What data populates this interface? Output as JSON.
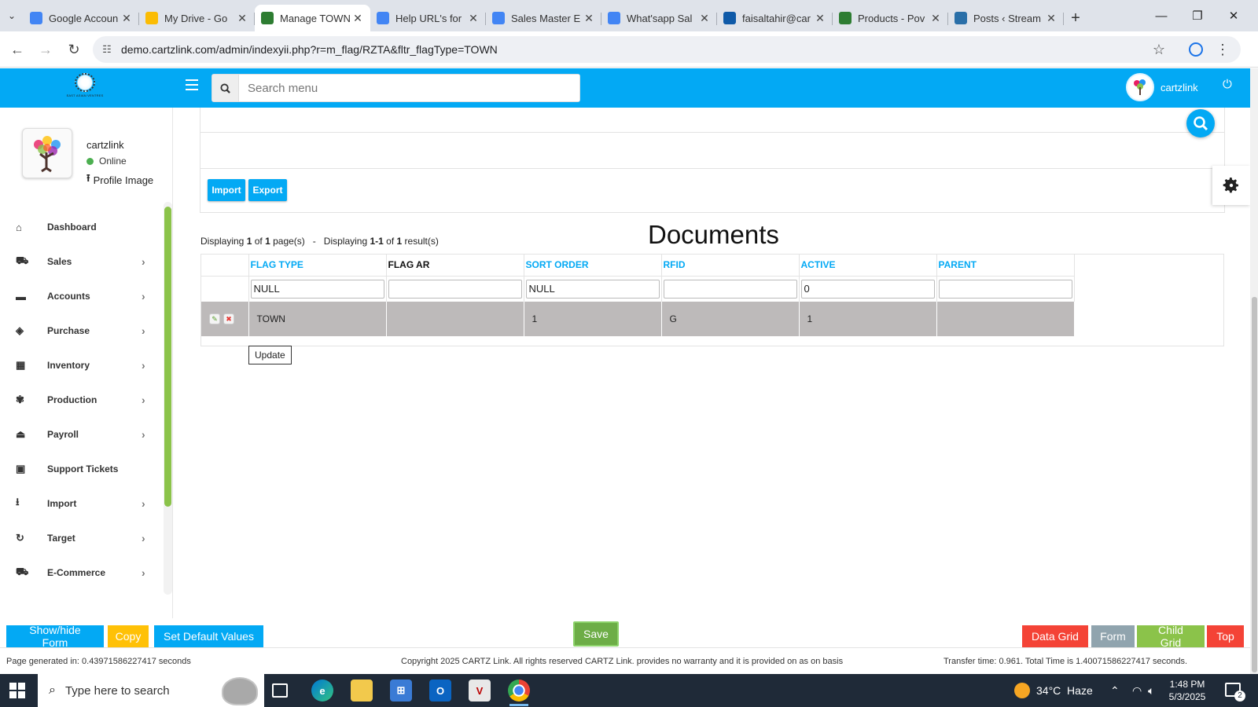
{
  "browser": {
    "tabs": [
      {
        "title": "Google Accoun",
        "favicon": "google-icon",
        "color": "#4285f4"
      },
      {
        "title": "My Drive - Go",
        "favicon": "drive-icon",
        "color": "#fbbc04"
      },
      {
        "title": "Manage TOWN",
        "favicon": "cartzlink-icon",
        "color": "#2e7d32",
        "active": true
      },
      {
        "title": "Help URL's for",
        "favicon": "docs-icon",
        "color": "#4285f4"
      },
      {
        "title": "Sales Master E",
        "favicon": "docs-icon",
        "color": "#4285f4"
      },
      {
        "title": "What'sapp Sal",
        "favicon": "docs-icon",
        "color": "#4285f4"
      },
      {
        "title": "faisaltahir@car",
        "favicon": "mail-icon",
        "color": "#0f5aa8"
      },
      {
        "title": "Products - Pov",
        "favicon": "cartzlink-icon",
        "color": "#2e7d32"
      },
      {
        "title": "Posts ‹ Stream",
        "favicon": "wordpress-icon",
        "color": "#2a6fa8"
      }
    ],
    "url": "demo.cartzlink.com/admin/indexyii.php?r=m_flag/RZTA&fltr_flagType=TOWN"
  },
  "header": {
    "logo_text": "EAST ASIAN VENTRES",
    "search_placeholder": "Search menu",
    "user_name": "cartzlink",
    "accent": "#03a9f4"
  },
  "profile": {
    "name": "cartzlink",
    "status": "Online",
    "upload_label": "Profile Image"
  },
  "sidebar": {
    "items": [
      {
        "label": "Dashboard",
        "icon": "home-icon",
        "glyph": "⌂",
        "has_children": false
      },
      {
        "label": "Sales",
        "icon": "cart-icon",
        "glyph": "⛟",
        "has_children": true
      },
      {
        "label": "Accounts",
        "icon": "briefcase-icon",
        "glyph": "▬",
        "has_children": true
      },
      {
        "label": "Purchase",
        "icon": "tags-icon",
        "glyph": "◈",
        "has_children": true
      },
      {
        "label": "Inventory",
        "icon": "grid-icon",
        "glyph": "▦",
        "has_children": true
      },
      {
        "label": "Production",
        "icon": "cogs-icon",
        "glyph": "✾",
        "has_children": true
      },
      {
        "label": "Payroll",
        "icon": "money-icon",
        "glyph": "⏏",
        "has_children": true
      },
      {
        "label": "Support Tickets",
        "icon": "ticket-icon",
        "glyph": "▣",
        "has_children": false
      },
      {
        "label": "Import",
        "icon": "download-icon",
        "glyph": "⭳",
        "has_children": true
      },
      {
        "label": "Target",
        "icon": "refresh-icon",
        "glyph": "↻",
        "has_children": true
      },
      {
        "label": "E-Commerce",
        "icon": "shopping-cart-icon",
        "glyph": "⛟",
        "has_children": true
      }
    ]
  },
  "toolbar": {
    "import_label": "Import",
    "export_label": "Export"
  },
  "listing": {
    "displaying_pages_prefix": "Displaying ",
    "page_current": "1",
    "of": " of ",
    "page_total": "1",
    "pages_suffix": " page(s)   -   Displaying ",
    "range": "1-1",
    "of2": " of ",
    "result_total": "1",
    "results_suffix": " result(s)",
    "title": "Documents"
  },
  "grid": {
    "columns": [
      "FLAG TYPE",
      "FLAG AR",
      "SORT ORDER",
      "RFID",
      "ACTIVE",
      "PARENT"
    ],
    "filters": [
      "NULL",
      "",
      "NULL",
      "",
      "0",
      ""
    ],
    "rows": [
      [
        "TOWN",
        "",
        "1",
        "G",
        "1",
        ""
      ]
    ],
    "tooltip": "Update"
  },
  "actions": {
    "show_hide_form": "Show/hide Form",
    "copy": "Copy",
    "set_default_values": "Set Default Values",
    "save": "Save",
    "data_grid": "Data Grid",
    "form": "Form",
    "child_grid": "Child Grid",
    "top": "Top"
  },
  "footer": {
    "generated": "Page generated in: 0.43971586227417 seconds",
    "copyright": "Copyright 2025 CARTZ Link. All rights reserved CARTZ Link. provides no warranty and it is provided on as on basis",
    "transfer": "Transfer time: 0.961. Total Time is 1.40071586227417 seconds."
  },
  "taskbar": {
    "search_placeholder": "Type here to search",
    "weather": "34°C  Haze",
    "time": "1:48 PM",
    "date": "5/3/2025",
    "notifications": "2"
  }
}
